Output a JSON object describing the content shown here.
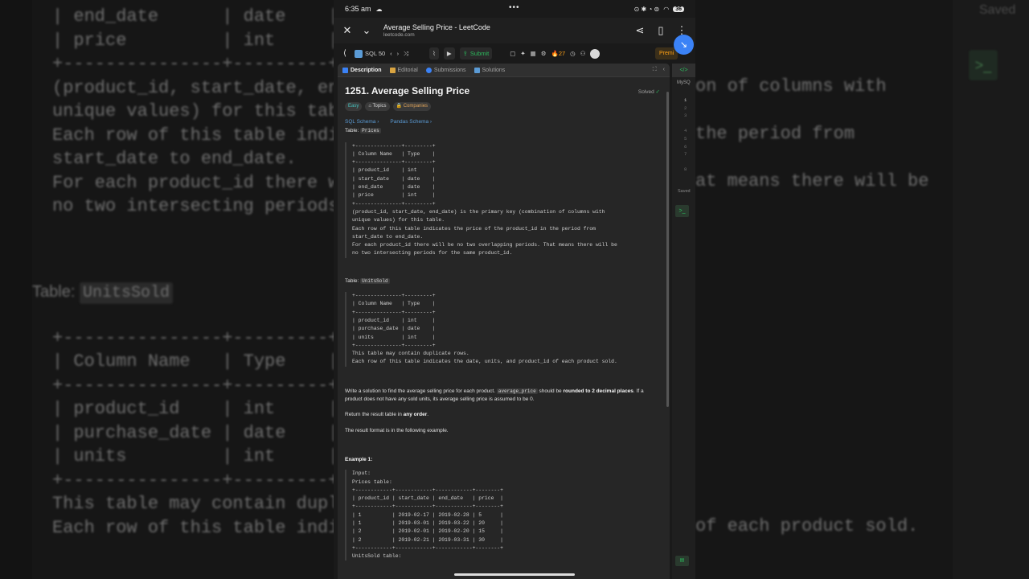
{
  "background": {
    "left_lines": [
      "| end_date      | date    |",
      "| price         | int     |",
      "+---------------+---------+",
      "(product_id, start_date, end",
      "unique values) for this tabl",
      "Each row of this table indic",
      "start_date to end_date.",
      "For each product_id there wi",
      "no two intersecting periods"
    ],
    "table_label": "Table:",
    "table_code": "UnitsSold",
    "left_lines2": [
      "+---------------+---------+",
      "| Column Name   | Type    |",
      "+---------------+---------+",
      "| product_id    | int     |",
      "| purchase_date | date    |",
      "| units         | int     |",
      "+---------------+---------+",
      "This table may contain dupli",
      "Each row of this table indic"
    ],
    "right_lines": [
      "on of columns with",
      "the period from",
      "at means there will be",
      "of each product sold."
    ],
    "saved": "Saved",
    "terminal_glyph": ">_"
  },
  "status_bar": {
    "time": "6:35 am",
    "cloud_icon": "cloud-icon",
    "dots": "•••",
    "right_icons": "⊙ ✱ ◔ ⊜",
    "battery": "36"
  },
  "app_bar": {
    "title": "Average Selling Price - LeetCode",
    "url": "leetcode.com"
  },
  "toolbar": {
    "sql50": "SQL 50",
    "submit": "Submit",
    "streak": "27",
    "premium": "Premi"
  },
  "tabs": {
    "description": "Description",
    "editorial": "Editorial",
    "submissions": "Submissions",
    "solutions": "Solutions"
  },
  "problem": {
    "title": "1251. Average Selling Price",
    "solved": "Solved",
    "chips": {
      "easy": "Easy",
      "topics": "Topics",
      "companies": "Companies"
    },
    "schema_sql": "SQL Schema",
    "schema_pandas": "Pandas Schema",
    "table1_label": "Table:",
    "table1_name": "Prices",
    "table1_block": "+---------------+---------+\n| Column Name   | Type    |\n+---------------+---------+\n| product_id    | int     |\n| start_date    | date    |\n| end_date      | date    |\n| price         | int     |\n+---------------+---------+\n(product_id, start_date, end_date) is the primary key (combination of columns with\nunique values) for this table.\nEach row of this table indicates the price of the product_id in the period from\nstart_date to end_date.\nFor each product_id there will be no two overlapping periods. That means there will be\nno two intersecting periods for the same product_id.",
    "table2_label": "Table:",
    "table2_name": "UnitsSold",
    "table2_block": "+---------------+---------+\n| Column Name   | Type    |\n+---------------+---------+\n| product_id    | int     |\n| purchase_date | date    |\n| units         | int     |\n+---------------+---------+\nThis table may contain duplicate rows.\nEach row of this table indicates the date, units, and product_id of each product sold.",
    "task_1": "Write a solution to find the average selling price for each product.",
    "task_code": "average_price",
    "task_2": "should be",
    "task_bold": "rounded to 2 decimal places",
    "task_3": ". If a product does not have any sold units, its average selling price is assumed to be 0.",
    "return_1": "Return the result table in",
    "return_bold": "any order",
    "return_2": ".",
    "format": "The result format is in the following example.",
    "example_title": "Example 1:",
    "example_block": "Input:\nPrices table:\n+------------+------------+------------+--------+\n| product_id | start_date | end_date   | price  |\n+------------+------------+------------+--------+\n| 1          | 2019-02-17 | 2019-02-28 | 5      |\n| 1          | 2019-03-01 | 2019-03-22 | 20     |\n| 2          | 2019-02-01 | 2019-02-20 | 15     |\n| 2          | 2019-02-21 | 2019-03-31 | 30     |\n+------------+------------+------------+--------+\nUnitsSold table:"
  },
  "editor": {
    "label": "MySQ",
    "line_numbers": [
      "1",
      "2",
      "3",
      "",
      "4",
      "5",
      "6",
      "7",
      "",
      "8"
    ],
    "saved": "Saved"
  }
}
